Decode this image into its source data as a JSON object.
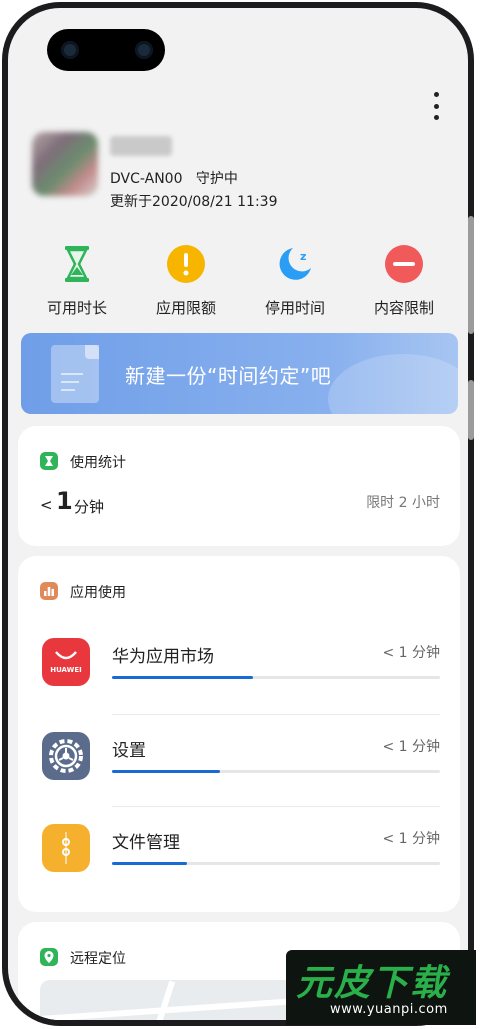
{
  "device_header": {
    "device_model": "DVC-AN00",
    "protection_status": "守护中",
    "updated_text": "更新于2020/08/21 11:39"
  },
  "quick_actions": [
    {
      "label": "可用时长",
      "icon": "hourglass-icon",
      "color": "#2fb45a"
    },
    {
      "label": "应用限额",
      "icon": "alert-icon",
      "color": "#f5b400"
    },
    {
      "label": "停用时间",
      "icon": "moon-sleep-icon",
      "color": "#2a9df4"
    },
    {
      "label": "内容限制",
      "icon": "no-entry-icon",
      "color": "#f05050"
    }
  ],
  "banner": {
    "text": "新建一份“时间约定”吧"
  },
  "usage_stats": {
    "title": "使用统计",
    "less_than": "<",
    "value": "1",
    "unit": "分钟",
    "limit_text": "限时 2 小时"
  },
  "app_usage": {
    "title": "应用使用",
    "apps": [
      {
        "name": "华为应用市场",
        "time": "< 1 分钟",
        "icon": "huawei-appgallery-icon",
        "icon_text": "HUAWEI",
        "usage_fraction": 0.43
      },
      {
        "name": "设置",
        "time": "< 1 分钟",
        "icon": "settings-gear-icon",
        "usage_fraction": 0.33
      },
      {
        "name": "文件管理",
        "time": "< 1 分钟",
        "icon": "file-manager-icon",
        "usage_fraction": 0.23
      }
    ]
  },
  "remote_location": {
    "title": "远程定位"
  },
  "watermark": {
    "big": "元皮下载",
    "small": "www.yuanpi.com"
  },
  "colors": {
    "accent": "#1a6ad6",
    "banner": "#7aa7ea"
  }
}
